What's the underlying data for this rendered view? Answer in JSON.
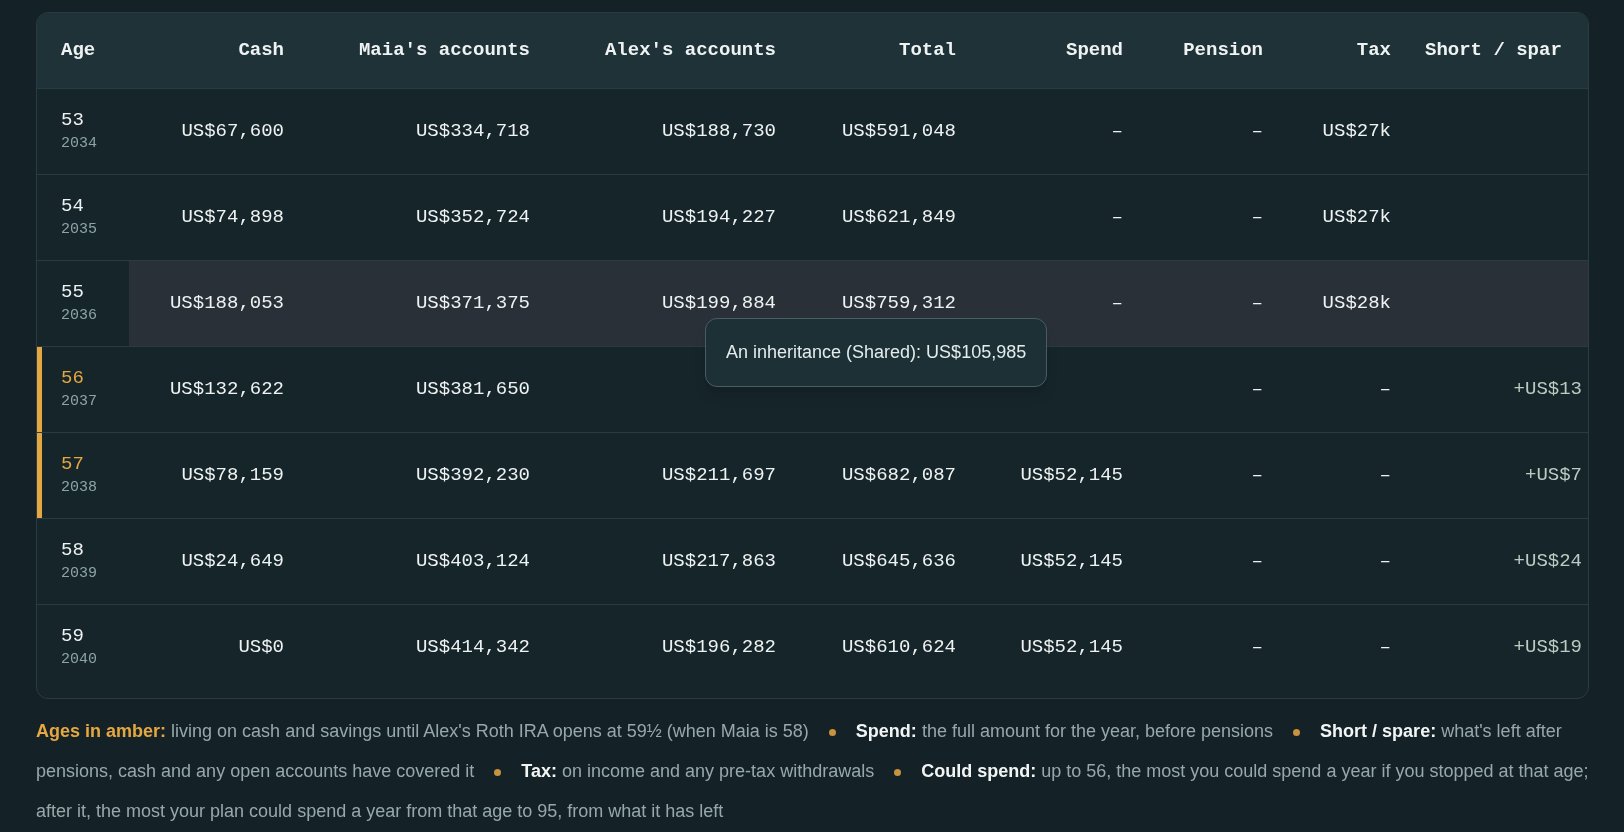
{
  "table": {
    "age_header": "Age",
    "columns": [
      "Cash",
      "Maia's accounts",
      "Alex's accounts",
      "Total",
      "Spend",
      "Pension",
      "Tax",
      "Short / spar"
    ],
    "rows": [
      {
        "age": "53",
        "year": "2034",
        "amber": false,
        "selected": false,
        "cells": [
          "US$67,600",
          "US$334,718",
          "US$188,730",
          "US$591,048",
          "–",
          "–",
          "US$27k",
          null
        ]
      },
      {
        "age": "54",
        "year": "2035",
        "amber": false,
        "selected": false,
        "cells": [
          "US$74,898",
          "US$352,724",
          "US$194,227",
          "US$621,849",
          "–",
          "–",
          "US$27k",
          null
        ]
      },
      {
        "age": "55",
        "year": "2036",
        "amber": false,
        "selected": true,
        "cells": [
          "US$188,053",
          "US$371,375",
          "US$199,884",
          "US$759,312",
          "–",
          "–",
          "US$28k",
          null
        ]
      },
      {
        "age": "56",
        "year": "2037",
        "amber": true,
        "selected": false,
        "cells": [
          "US$132,622",
          "US$381,650",
          null,
          null,
          null,
          "–",
          "–",
          "+US$13"
        ]
      },
      {
        "age": "57",
        "year": "2038",
        "amber": true,
        "selected": false,
        "cells": [
          "US$78,159",
          "US$392,230",
          "US$211,697",
          "US$682,087",
          "US$52,145",
          "–",
          "–",
          "+US$7"
        ]
      },
      {
        "age": "58",
        "year": "2039",
        "amber": false,
        "selected": false,
        "cells": [
          "US$24,649",
          "US$403,124",
          "US$217,863",
          "US$645,636",
          "US$52,145",
          "–",
          "–",
          "+US$24"
        ]
      },
      {
        "age": "59",
        "year": "2040",
        "amber": false,
        "selected": false,
        "cells": [
          "US$0",
          "US$414,342",
          "US$196,282",
          "US$610,624",
          "US$52,145",
          "–",
          "–",
          "+US$19"
        ]
      }
    ],
    "tooltip": "An inheritance (Shared): US$105,985"
  },
  "legend": [
    {
      "label": "Ages in amber:",
      "text": "living on cash and savings until Alex's Roth IRA opens at 59½ (when Maia is 58)",
      "amber": true
    },
    {
      "label": "Spend:",
      "text": "the full amount for the year, before pensions",
      "amber": false
    },
    {
      "label": "Short / spare:",
      "text": "what's left after pensions, cash and any open accounts have covered it",
      "amber": false
    },
    {
      "label": "Tax:",
      "text": "on income and any pre-tax withdrawals",
      "amber": false
    },
    {
      "label": "Could spend:",
      "text": "up to 56, the most you could spend a year if you stopped at that age; after it, the most your plan could spend a year from that age to 95, from what it has left",
      "amber": false
    }
  ]
}
